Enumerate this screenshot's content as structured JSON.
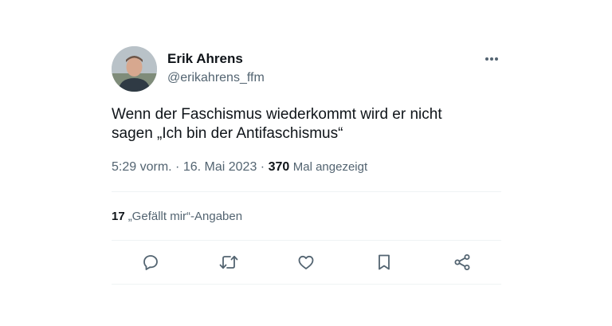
{
  "author": {
    "display_name": "Erik Ahrens",
    "handle": "@erikahrens_ffm"
  },
  "tweet": {
    "text_line1": "Wenn der Faschismus wiederkommt wird er nicht",
    "text_line2": "sagen „Ich bin der Antifaschismus“",
    "time": "5:29 vorm.",
    "date": "16. Mai 2023",
    "views_count": "370",
    "views_label": "Mal angezeigt"
  },
  "engagement": {
    "likes_count": "17",
    "likes_label": "„Gefällt mir“-Angaben"
  },
  "icons": {
    "more": "more-icon",
    "reply": "reply-icon",
    "retweet": "retweet-icon",
    "like": "heart-icon",
    "bookmark": "bookmark-icon",
    "share": "share-icon"
  },
  "colors": {
    "text_primary": "#0f1419",
    "text_secondary": "#536471",
    "divider": "#eff3f4"
  }
}
